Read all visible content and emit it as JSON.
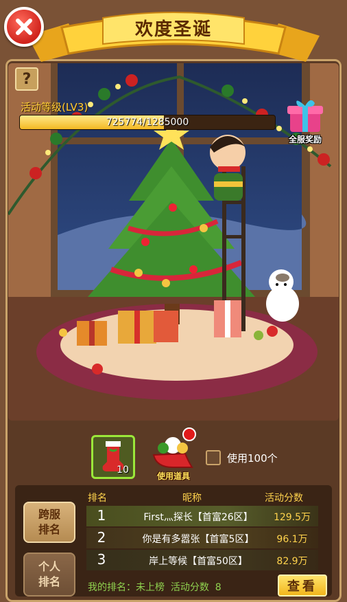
{
  "header": {
    "title": "欢度圣诞",
    "close_icon": "close-icon"
  },
  "activity": {
    "level_label": "活动等级(LV3)",
    "progress_text": "725774/1285000",
    "progress_fraction": 0.565,
    "server_reward_label": "全服奖励"
  },
  "items": {
    "sock_count": "10",
    "use_item_label": "使用道具",
    "use_multiple_label": "使用100个"
  },
  "ranking": {
    "tab_cross_server": "跨服排名",
    "tab_personal": "个人排名",
    "columns": {
      "rank": "排名",
      "nickname": "昵称",
      "score": "活动分数"
    },
    "rows": [
      {
        "rank": "1",
        "name": "First灬探长【首富26区】",
        "score": "129.5万"
      },
      {
        "rank": "2",
        "name": "你是有多嚣张【首富5区】",
        "score": "96.1万"
      },
      {
        "rank": "3",
        "name": "岸上等候【首富50区】",
        "score": "82.9万"
      }
    ],
    "my_rank_text": "我的排名：未上榜  活动分数  8",
    "view_button": "查看"
  }
}
